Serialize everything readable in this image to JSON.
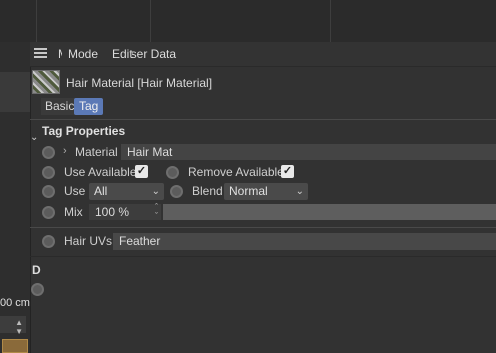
{
  "menu": {
    "mode": "Mode",
    "edit": "Edit",
    "user_data": "User Data"
  },
  "object": {
    "name": "Hair Material [Hair Material]"
  },
  "tabs": [
    {
      "label": "Basic"
    },
    {
      "label": "Tag"
    }
  ],
  "section_title": "Tag Properties",
  "material": {
    "label": "Material",
    "value": "Hair Mat"
  },
  "use_available": {
    "label": "Use Available",
    "checked": true
  },
  "remove_available": {
    "label": "Remove Available",
    "checked": true
  },
  "use": {
    "label": "Use",
    "value": "All"
  },
  "blend": {
    "label": "Blend",
    "value": "Normal"
  },
  "mix": {
    "label": "Mix",
    "value": "100 %",
    "fraction": 1.0
  },
  "hair_uvs": {
    "label": "Hair UVs",
    "value": "Feather"
  },
  "left_panel": {
    "letter_d": "D",
    "unit_text": "00 cm"
  },
  "colors": {
    "accent_tab": "#5b79b6",
    "panel_bg": "#323232"
  }
}
